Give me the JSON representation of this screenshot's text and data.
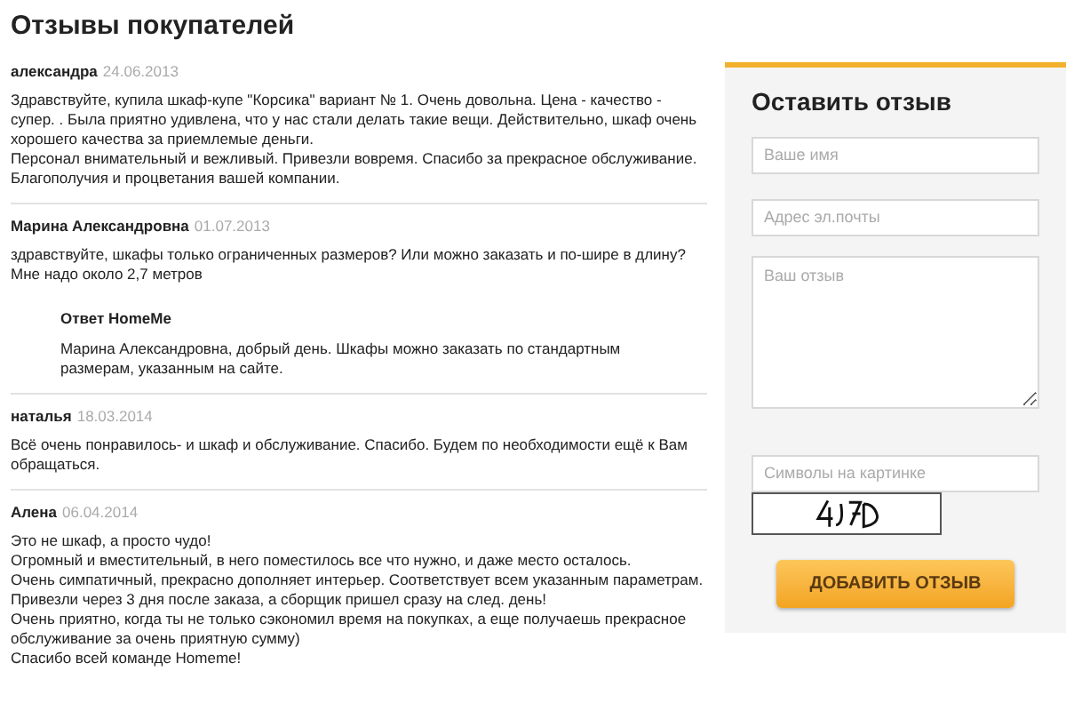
{
  "title": "Отзывы покупателей",
  "reviews": [
    {
      "author": "александра",
      "date": "24.06.2013",
      "paragraphs": [
        "Здравствуйте, купила шкаф-купе \"Корсика\" вариант № 1. Очень довольна. Цена - качество - супер. . Была приятно удивлена, что у нас стали делать такие вещи. Действительно, шкаф очень хорошего качества за приемлемые деньги.",
        "Персонал внимательный и вежливый. Привезли вовремя. Спасибо за прекрасное обслуживание.",
        "Благополучия и процветания вашей компании."
      ]
    },
    {
      "author": "Марина Александровна",
      "date": "01.07.2013",
      "paragraphs": [
        "здравствуйте, шкафы только ограниченных размеров? Или можно заказать и по-шире в длину? Мне надо около 2,7 метров"
      ],
      "reply": {
        "title": "Ответ HomeMe",
        "text": "Марина Александровна, добрый день. Шкафы можно заказать по стандартным размерам, указанным на сайте."
      }
    },
    {
      "author": "наталья",
      "date": "18.03.2014",
      "paragraphs": [
        "Всё очень понравилось- и шкаф и обслуживание. Спасибо. Будем по необходимости ещё к Вам обращаться."
      ]
    },
    {
      "author": "Алена",
      "date": "06.04.2014",
      "paragraphs": [
        "Это не шкаф, а просто чудо!",
        "Огромный и вместительный, в него поместилось все что нужно, и даже место осталось.",
        "Очень симпатичный, прекрасно дополняет интерьер. Соответствует всем указанным параметрам.",
        "Привезли через 3 дня после заказа, а сборщик пришел сразу на след. день!",
        "Очень приятно, когда ты не только сэкономил время на покупках, а еще получаешь прекрасное обслуживание за очень приятную сумму)",
        "Спасибо всей команде Homeme!"
      ]
    }
  ],
  "form": {
    "title": "Оставить отзыв",
    "fields": [
      {
        "kind": "input",
        "placeholder": "Ваше имя"
      },
      {
        "kind": "input",
        "placeholder": "Адрес эл.почты"
      },
      {
        "kind": "textarea",
        "placeholder": "Ваш отзыв"
      },
      {
        "kind": "input",
        "placeholder": "Символы на картинке"
      }
    ],
    "button": "ДОБАВИТЬ ОТЗЫВ"
  }
}
